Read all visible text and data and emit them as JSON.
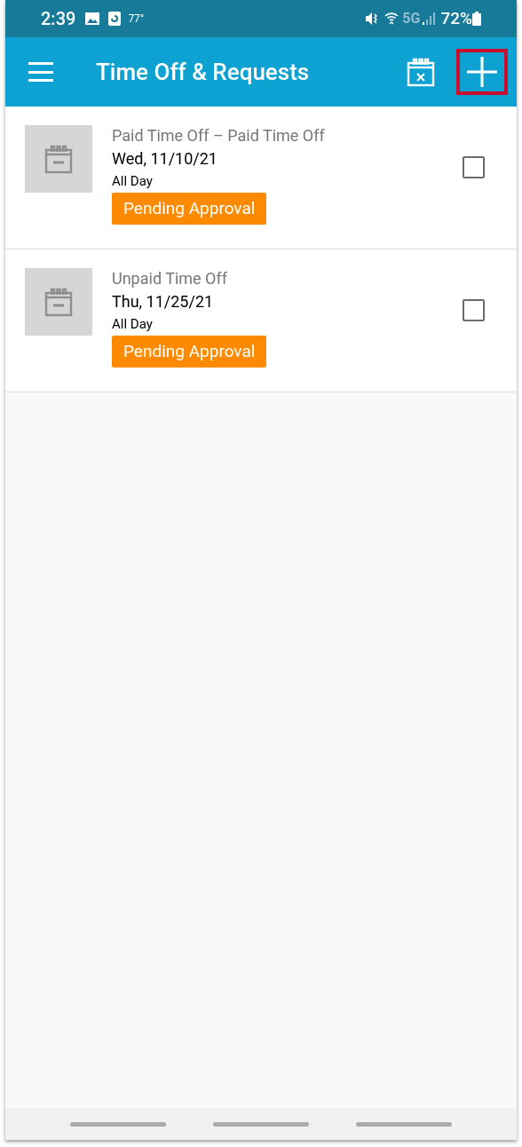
{
  "status_bar": {
    "time": "2:39",
    "temperature": "77°",
    "network": "5G",
    "battery": "72%"
  },
  "app_bar": {
    "title": "Time Off & Requests",
    "add_button": {
      "highlighted": true
    }
  },
  "requests": [
    {
      "type": "Paid Time Off – Paid Time Off",
      "date": "Wed, 11/10/21",
      "duration": "All Day",
      "status": "Pending Approval",
      "checked": false
    },
    {
      "type": "Unpaid Time Off",
      "date": "Thu, 11/25/21",
      "duration": "All Day",
      "status": "Pending Approval",
      "checked": false
    }
  ]
}
